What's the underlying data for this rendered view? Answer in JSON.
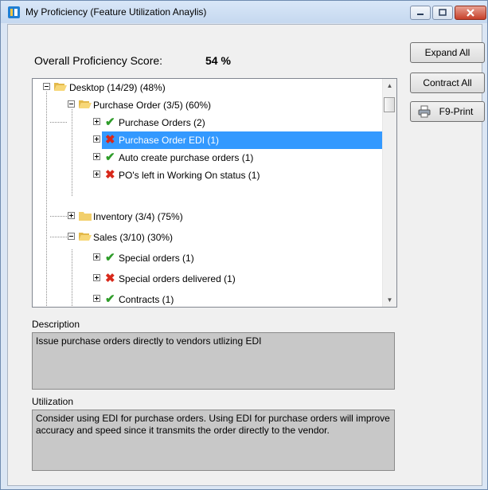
{
  "window": {
    "title": "My Proficiency  (Feature Utilization Anaylis)",
    "icons": [
      "app-icon",
      "minimize-icon",
      "maximize-icon",
      "close-icon"
    ]
  },
  "score": {
    "label": "Overall Proficiency Score:",
    "value": "54 %"
  },
  "tree": {
    "nodes": [
      {
        "label": "Desktop (14/29)  (48%)",
        "type": "folder",
        "expanded": true,
        "level": 0
      },
      {
        "label": "Purchase Order (3/5)  (60%)",
        "type": "folder",
        "expanded": true,
        "level": 1
      },
      {
        "label": "Purchase Orders (2)",
        "status": "check",
        "level": 2
      },
      {
        "label": "Purchase Order EDI (1)",
        "status": "cross",
        "level": 2,
        "selected": true
      },
      {
        "label": "Auto create purchase orders (1)",
        "status": "check",
        "level": 2
      },
      {
        "label": "PO's left in Working On status (1)",
        "status": "cross",
        "level": 2
      },
      {
        "label": "Inventory (3/4)  (75%)",
        "type": "folder",
        "expanded": false,
        "level": 1
      },
      {
        "label": "Sales (3/10)  (30%)",
        "type": "folder",
        "expanded": true,
        "level": 1
      },
      {
        "label": "Special orders (1)",
        "status": "check",
        "level": 2
      },
      {
        "label": "Special orders delivered (1)",
        "status": "cross",
        "level": 2
      },
      {
        "label": "Contracts (1)",
        "status": "check",
        "level": 2
      }
    ]
  },
  "description": {
    "label": "Description",
    "text": "Issue purchase orders directly to vendors utlizing EDI"
  },
  "utilization": {
    "label": "Utilization",
    "text": "Consider using EDI for purchase orders.  Using EDI for purchase orders will improve accuracy and speed since it transmits the order directly to the vendor."
  },
  "buttons": {
    "expand_all": "Expand All",
    "contract_all": "Contract All",
    "print": "F9-Print"
  },
  "colors": {
    "selection": "#3399ff",
    "check": "#2e9c29",
    "cross": "#d8291b",
    "panel": "#c8c8c8"
  }
}
